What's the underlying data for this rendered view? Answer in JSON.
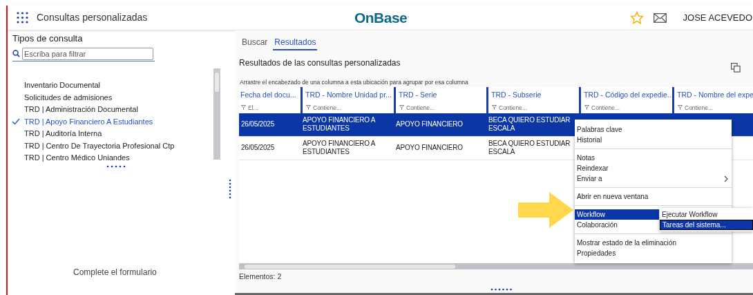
{
  "header": {
    "apps_title": "Consultas personalizadas",
    "logo": "OnBase",
    "logo_mark": "·",
    "user": "JOSE ACEVEDO"
  },
  "left_panel": {
    "heading": "Tipos de consulta",
    "filter_placeholder": "Escriba para filtrar",
    "items": [
      {
        "label": "Inventario Documental",
        "selected": false
      },
      {
        "label": "Solicitudes de admisiones",
        "selected": false
      },
      {
        "label": "TRD | Administración Documental",
        "selected": false
      },
      {
        "label": "TRD | Apoyo Financiero A Estudiantes",
        "selected": true
      },
      {
        "label": "TRD | Auditoría Interna",
        "selected": false
      },
      {
        "label": "TRD | Centro De Trayectoria Profesional Ctp",
        "selected": false
      },
      {
        "label": "TRD | Centro Médico Uniandes",
        "selected": false
      }
    ],
    "footer_text": "Complete el formulario"
  },
  "results": {
    "tabs": [
      {
        "label": "Buscar",
        "selected": false
      },
      {
        "label": "Resultados",
        "selected": true
      }
    ],
    "heading": "Resultados de las consultas personalizadas",
    "group_hint": "Arrastre el encabezado de una columna a esta ubicación para agrupar por esa columna",
    "columns": [
      {
        "label": "Fecha del docu...",
        "filter": "El..."
      },
      {
        "label": "TRD - Nombre Unidad pr...",
        "filter": "Contiene..."
      },
      {
        "label": "TRD - Serie",
        "filter": "Contiene..."
      },
      {
        "label": "TRD - Subserie",
        "filter": "Contiene..."
      },
      {
        "label": "TRD - Código del expedie...",
        "filter": "Contiene..."
      },
      {
        "label": "TRD - Nombre del expe",
        "filter": "Contiene..."
      }
    ],
    "rows": [
      {
        "selected": true,
        "cells": [
          "26/05/2025",
          "APOYO FINANCIERO A ESTUDIANTES",
          "APOYO FINANCIERO",
          "BECA QUIERO ESTUDIAR ESCALA"
        ]
      },
      {
        "selected": false,
        "cells": [
          "26/05/2025",
          "APOYO FINANCIERO A ESTUDIANTES",
          "APOYO FINANCIERO",
          "BECA QUIERO ESTUDIAR ESCALA"
        ]
      }
    ],
    "status": "Elementos: 2"
  },
  "context_menu": {
    "groups": [
      [
        {
          "label": "Palabras clave",
          "selected": false,
          "submenu": false
        },
        {
          "label": "Historial",
          "selected": false,
          "submenu": false
        }
      ],
      [
        {
          "label": "Notas",
          "selected": false,
          "submenu": false
        },
        {
          "label": "Reindexar",
          "selected": false,
          "submenu": false
        },
        {
          "label": "Enviar a",
          "selected": false,
          "submenu": true
        }
      ],
      [
        {
          "label": "Abrir en nueva ventana",
          "selected": false,
          "submenu": false
        }
      ],
      [
        {
          "label": "Workflow",
          "selected": true,
          "submenu": false
        },
        {
          "label": "Colaboración",
          "selected": false,
          "submenu": false
        }
      ],
      [
        {
          "label": "Mostrar estado de la eliminación",
          "selected": false,
          "submenu": false
        },
        {
          "label": "Propiedades",
          "selected": false,
          "submenu": false
        }
      ]
    ],
    "submenu": [
      {
        "label": "Ejecutar Workflow",
        "selected": false
      },
      {
        "label": "Tareas del sistema...",
        "selected": true
      }
    ]
  }
}
